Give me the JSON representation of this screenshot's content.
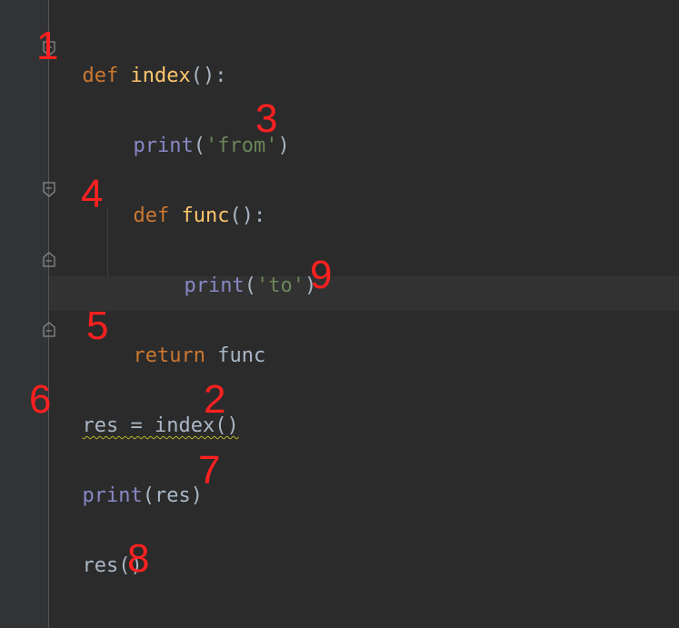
{
  "code": {
    "line1": {
      "kw": "def",
      "name": "index",
      "rest": "():"
    },
    "line2": {
      "fn": "print",
      "open": "(",
      "str": "'from'",
      "close": ")"
    },
    "line3": {
      "kw": "def",
      "name": "func",
      "rest": "():"
    },
    "line4": {
      "fn": "print",
      "open": "(",
      "str": "'to'",
      "close": ")"
    },
    "line5": {
      "kw": "return",
      "rest": "func"
    },
    "line6": {
      "text": "res = index()"
    },
    "line7": {
      "fn": "print",
      "rest": "(res)"
    },
    "line8": {
      "text": "res()"
    }
  },
  "annotations": {
    "n1": "1",
    "n2": "2",
    "n3": "3",
    "n4": "4",
    "n5": "5",
    "n6": "6",
    "n7": "7",
    "n8": "8",
    "n9": "9"
  },
  "colors": {
    "background": "#2b2b2b",
    "keyword": "#cc7832",
    "function_name": "#ffc66d",
    "builtin": "#8888c6",
    "string": "#6a8759",
    "default_text": "#a9b7c6",
    "annotation": "#ff2020"
  }
}
